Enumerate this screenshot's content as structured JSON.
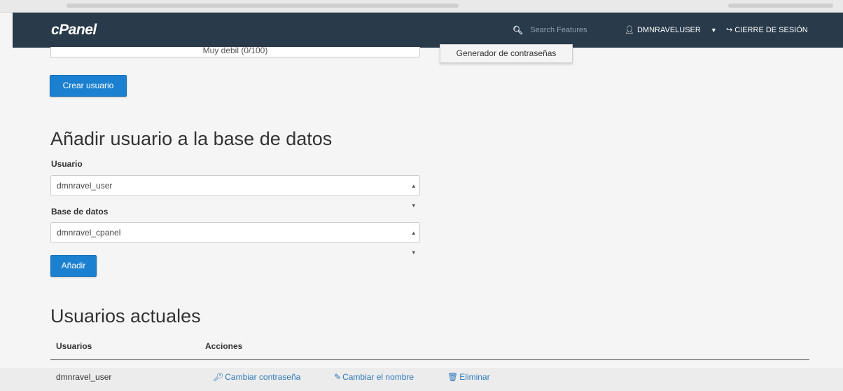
{
  "header": {
    "logo": "cPanel",
    "search_placeholder": "Search Features",
    "username": "DMNRAVELUSER",
    "logout_label": "CIERRE DE SESIÓN"
  },
  "create_user": {
    "strength_text": "Muy debil (0/100)",
    "generator_label": "Generador de contraseñas",
    "create_button": "Crear usuario"
  },
  "add_user_to_db": {
    "title": "Añadir usuario a la base de datos",
    "user_label": "Usuario",
    "user_value": "dmnravel_user",
    "db_label": "Base de datos",
    "db_value": "dmnravel_cpanel",
    "add_button": "Añadir"
  },
  "current_users": {
    "title": "Usuarios actuales",
    "columns": [
      "Usuarios",
      "Acciones"
    ],
    "rows": [
      {
        "user": "dmnravel_user",
        "actions": [
          "Cambiar contraseña",
          "Cambiar el nombre",
          "Eliminar"
        ]
      }
    ]
  },
  "colors": {
    "topbar": "#293a4a",
    "primary": "#1b80d0",
    "link": "#2f79b9"
  }
}
